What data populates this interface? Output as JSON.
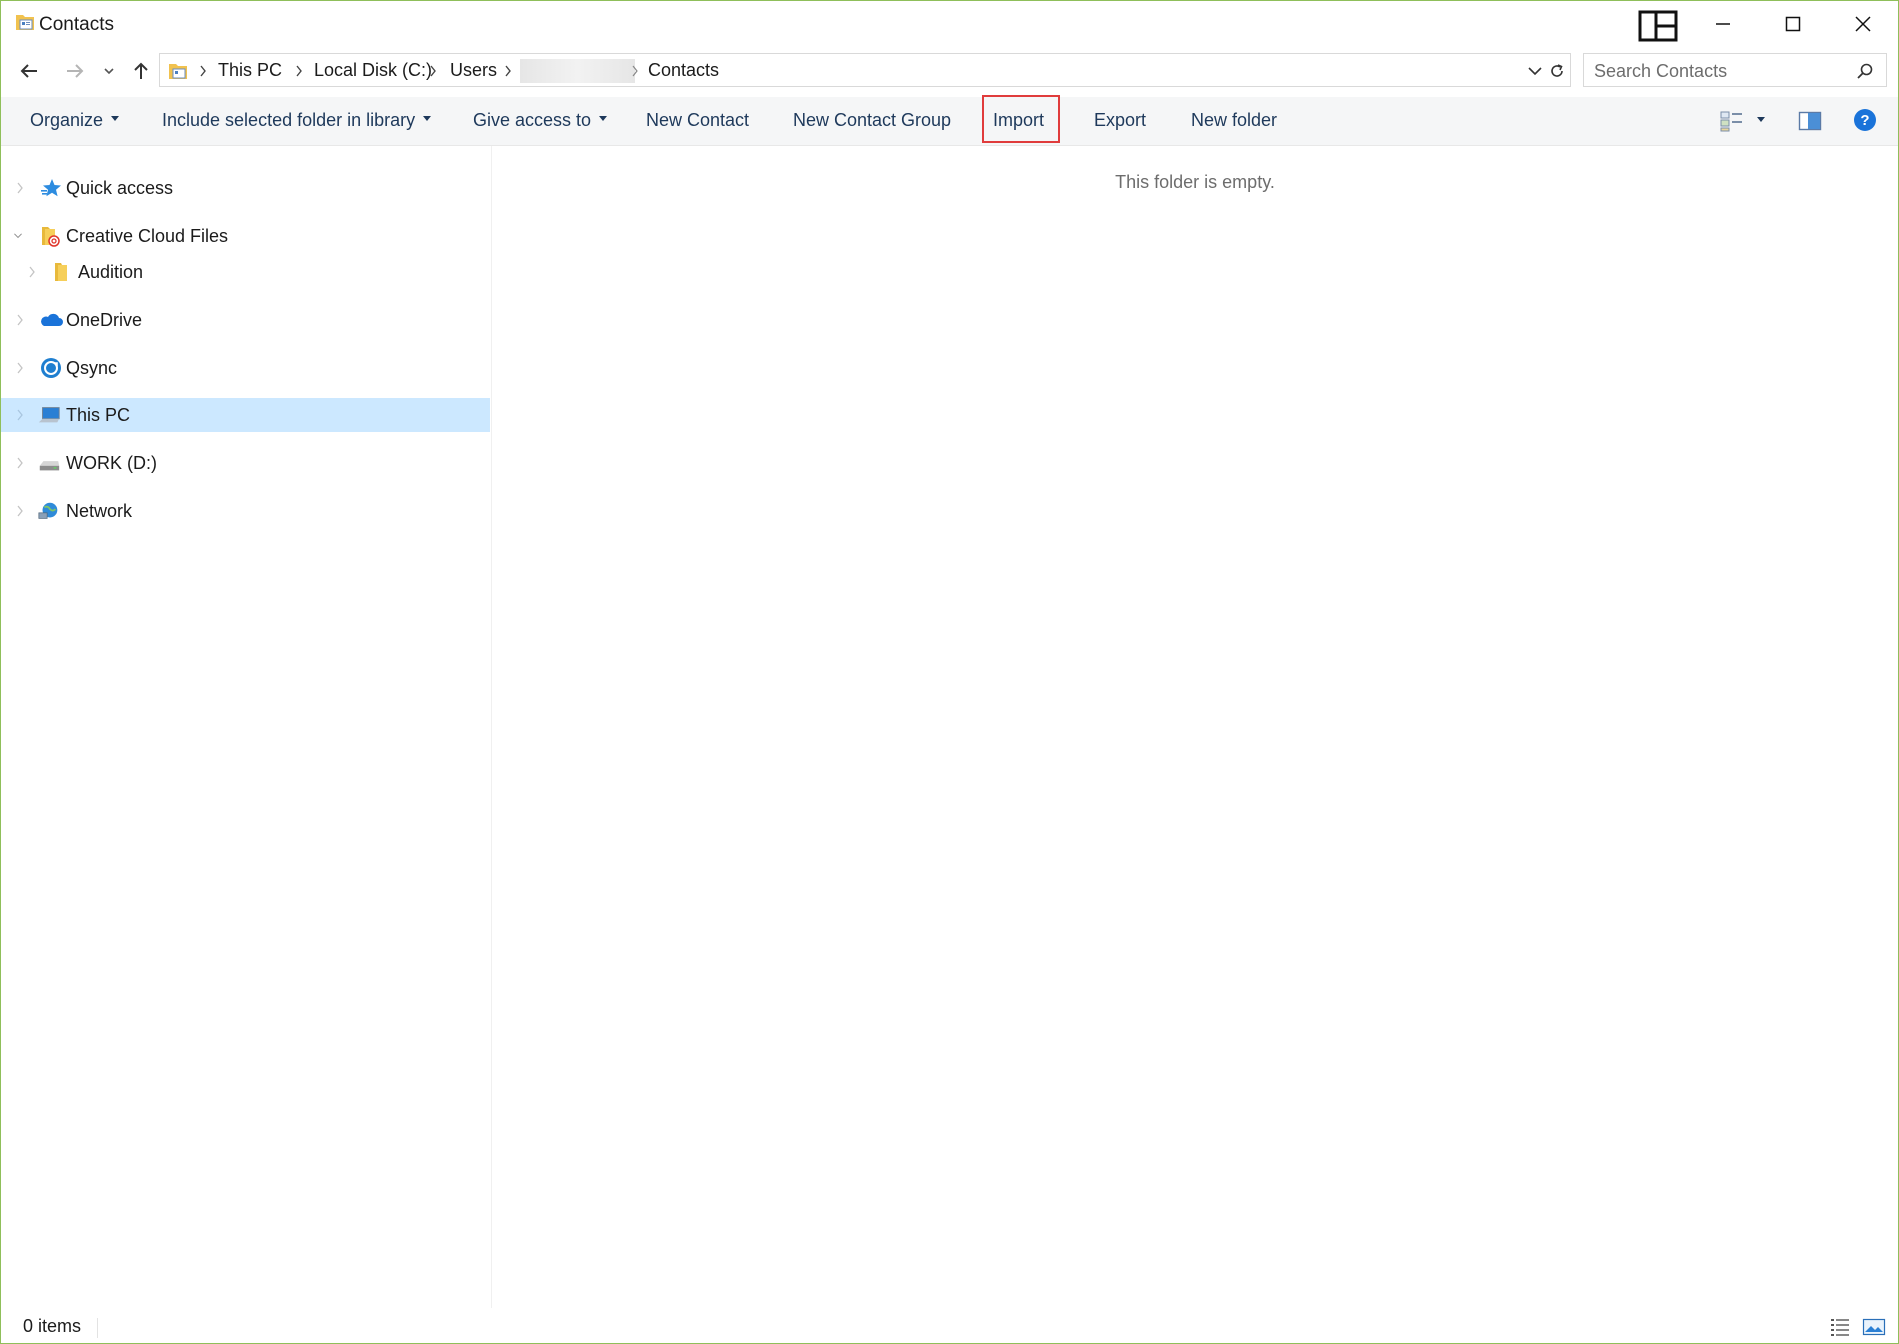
{
  "window": {
    "title": "Contacts",
    "colors": {
      "accent_border": "#8fbf5a",
      "highlight_box": "#e03c3c",
      "selected_bg": "#cce8ff",
      "command_text": "#1e395b"
    }
  },
  "icons": {
    "title": "contacts-folder-icon",
    "snap": "snap-layout-icon",
    "minimize": "minimize-icon",
    "maximize": "maximize-icon",
    "close": "close-icon",
    "back": "back-arrow-icon",
    "forward": "forward-arrow-icon",
    "recent": "chevron-down-icon",
    "up": "up-arrow-icon",
    "refresh": "refresh-icon",
    "search": "search-icon",
    "view_options": "change-view-icon",
    "preview_pane": "preview-pane-icon",
    "help": "help-icon"
  },
  "address": {
    "crumbs": [
      "This PC",
      "Local Disk (C:)",
      "Users",
      "Contacts"
    ],
    "redacted_segment": true
  },
  "search": {
    "placeholder": "Search Contacts",
    "value": ""
  },
  "commands": {
    "organize": "Organize",
    "include_library": "Include selected folder in library",
    "give_access": "Give access to",
    "new_contact": "New Contact",
    "new_contact_group": "New Contact Group",
    "import": "Import",
    "export": "Export",
    "new_folder": "New folder"
  },
  "nav_pane": {
    "items": [
      {
        "label": "Quick access",
        "icon": "star-icon",
        "expanded": false
      },
      {
        "label": "Creative Cloud Files",
        "icon": "creative-cloud-folder-icon",
        "expanded": true
      },
      {
        "label": "Audition",
        "icon": "folder-icon",
        "expanded": false
      },
      {
        "label": "OneDrive",
        "icon": "onedrive-cloud-icon",
        "expanded": false
      },
      {
        "label": "Qsync",
        "icon": "qsync-icon",
        "expanded": false
      },
      {
        "label": "This PC",
        "icon": "computer-icon",
        "expanded": false,
        "selected": true
      },
      {
        "label": "WORK (D:)",
        "icon": "drive-icon",
        "expanded": false
      },
      {
        "label": "Network",
        "icon": "network-icon",
        "expanded": false
      }
    ]
  },
  "content": {
    "empty_message": "This folder is empty."
  },
  "status": {
    "item_count": "0 items"
  }
}
